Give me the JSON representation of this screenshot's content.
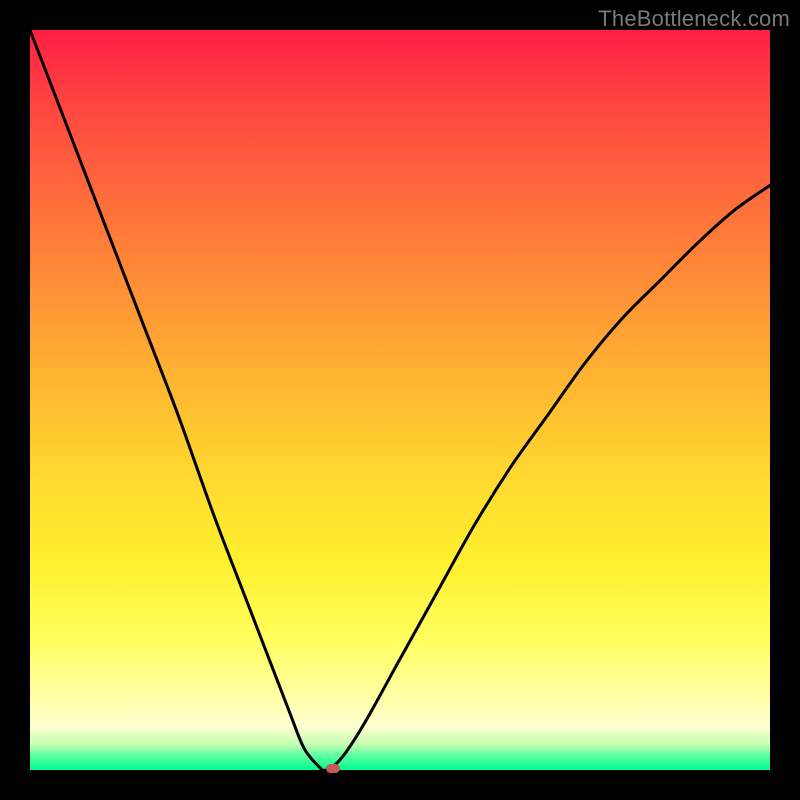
{
  "watermark": "TheBottleneck.com",
  "colors": {
    "frame": "#000000",
    "curve": "#000000",
    "marker": "#c85a5a",
    "gradient_top": "#ff1e44",
    "gradient_bottom": "#00ff90"
  },
  "chart_data": {
    "type": "line",
    "title": "",
    "xlabel": "",
    "ylabel": "",
    "xlim": [
      0,
      100
    ],
    "ylim": [
      0,
      100
    ],
    "x": [
      0,
      5,
      10,
      15,
      20,
      25,
      30,
      35,
      37,
      39,
      40,
      42,
      45,
      50,
      55,
      60,
      65,
      70,
      75,
      80,
      85,
      90,
      95,
      100
    ],
    "y": [
      100,
      87,
      74,
      61,
      48,
      34,
      21,
      8,
      3,
      0.5,
      0,
      1.5,
      6,
      15,
      24,
      33,
      41,
      48,
      55,
      61,
      66,
      71,
      75.5,
      79
    ],
    "marker": {
      "x": 41,
      "y": 0
    },
    "note": "Values are visual estimates of the black bottleneck curve on a 0–100 normalized scale; minimum at ~x=40."
  }
}
